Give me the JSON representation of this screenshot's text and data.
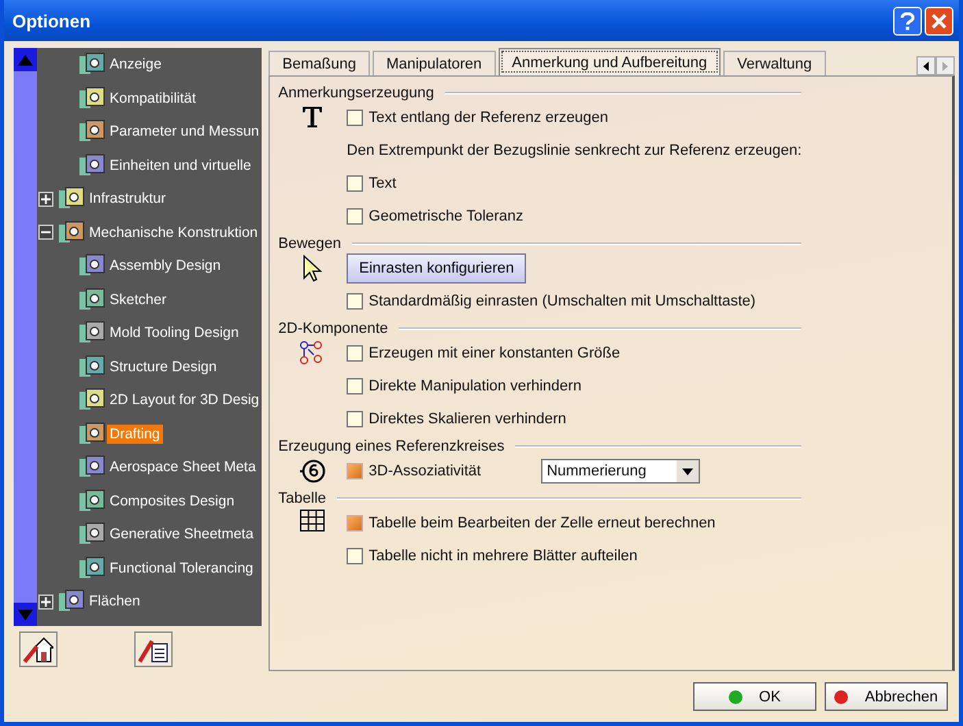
{
  "window": {
    "title": "Optionen"
  },
  "tree": {
    "continued_children": [
      {
        "label": "Anzeige",
        "selected": false
      },
      {
        "label": "Kompatibilität",
        "selected": false
      },
      {
        "label": "Parameter und Messun",
        "selected": false
      },
      {
        "label": "Einheiten und virtuelle",
        "selected": false
      }
    ],
    "items": [
      {
        "label": "Infrastruktur",
        "expanded": false,
        "selected": false
      },
      {
        "label": "Mechanische Konstruktion",
        "expanded": true,
        "selected": false,
        "children": [
          {
            "label": "Assembly Design",
            "selected": false
          },
          {
            "label": "Sketcher",
            "selected": false
          },
          {
            "label": "Mold Tooling Design",
            "selected": false
          },
          {
            "label": "Structure Design",
            "selected": false
          },
          {
            "label": "2D Layout for 3D Desig",
            "selected": false
          },
          {
            "label": "Drafting",
            "selected": true
          },
          {
            "label": "Aerospace Sheet Meta",
            "selected": false
          },
          {
            "label": "Composites Design",
            "selected": false
          },
          {
            "label": "Generative Sheetmeta",
            "selected": false
          },
          {
            "label": "Functional Tolerancing",
            "selected": false
          }
        ]
      },
      {
        "label": "Flächen",
        "expanded": false,
        "selected": false
      }
    ]
  },
  "tabs": [
    {
      "label": "Bemaßung",
      "selected": false
    },
    {
      "label": "Manipulatoren",
      "selected": false
    },
    {
      "label": "Anmerkung und Aufbereitung",
      "selected": true
    },
    {
      "label": "Verwaltung",
      "selected": false
    }
  ],
  "sections": [
    {
      "title": "Anmerkungserzeugung",
      "rows": [
        {
          "kind": "checkbox",
          "label": "Text entlang der Referenz erzeugen",
          "checked": false
        },
        {
          "kind": "note",
          "label": "Den Extrempunkt der Bezugslinie senkrecht zur Referenz erzeugen:"
        },
        {
          "kind": "checkbox",
          "label": "Text",
          "checked": false
        },
        {
          "kind": "checkbox",
          "label": "Geometrische Toleranz",
          "checked": false
        }
      ]
    },
    {
      "title": "Bewegen",
      "rows": [
        {
          "kind": "button",
          "label": "Einrasten konfigurieren"
        },
        {
          "kind": "checkbox",
          "label": "Standardmäßig einrasten (Umschalten mit Umschalttaste)",
          "checked": false
        }
      ]
    },
    {
      "title": "2D-Komponente",
      "rows": [
        {
          "kind": "checkbox",
          "label": "Erzeugen mit einer konstanten Größe",
          "checked": false
        },
        {
          "kind": "checkbox",
          "label": "Direkte Manipulation verhindern",
          "checked": false
        },
        {
          "kind": "checkbox",
          "label": "Direktes Skalieren verhindern",
          "checked": false
        }
      ]
    },
    {
      "title": "Erzeugung eines Referenzkreises",
      "rows": [
        {
          "kind": "checkbox_dropdown",
          "label": "3D-Assoziativität",
          "checked": true,
          "value": "Nummerierung"
        }
      ]
    },
    {
      "title": "Tabelle",
      "rows": [
        {
          "kind": "checkbox",
          "label": "Tabelle beim Bearbeiten der Zelle erneut berechnen",
          "checked": true
        },
        {
          "kind": "checkbox",
          "label": "Tabelle nicht in mehrere Blätter aufteilen",
          "checked": false
        }
      ]
    }
  ],
  "buttons": [
    {
      "label": "OK",
      "kind": "ok"
    },
    {
      "label": "Abbrechen",
      "kind": "cancel"
    }
  ]
}
